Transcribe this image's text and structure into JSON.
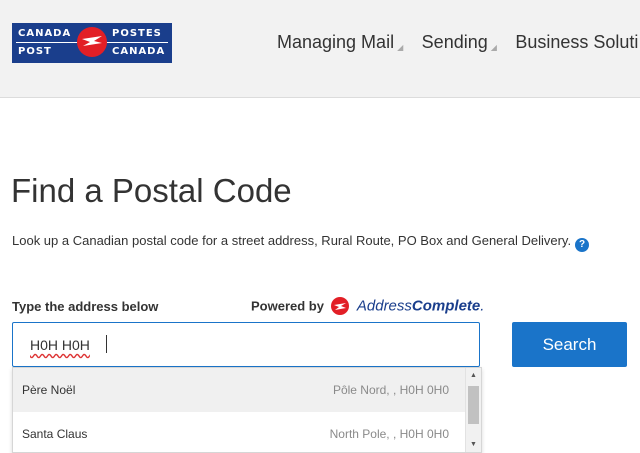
{
  "header": {
    "logo": {
      "line1_left": "CANADA",
      "line1_right": "POSTES",
      "line2_left": "POST",
      "line2_right": "CANADA"
    },
    "nav": [
      {
        "label": "Managing Mail"
      },
      {
        "label": "Sending"
      },
      {
        "label": "Business Soluti"
      }
    ]
  },
  "main": {
    "title": "Find a Postal Code",
    "description": "Look up a Canadian postal code for a street address, Rural Route, PO Box and General Delivery.",
    "help_icon": "?",
    "address_label": "Type the address below",
    "powered_by": "Powered by",
    "provider_name_part1": "Address",
    "provider_name_part2": "Complete",
    "provider_suffix": ".",
    "input_value": "H0H H0H",
    "search_label": "Search",
    "suggestions": [
      {
        "name": "Père Noël",
        "address": "Pôle Nord, , H0H 0H0"
      },
      {
        "name": "Santa Claus",
        "address": "North Pole, , H0H 0H0"
      }
    ]
  },
  "icons": {
    "scroll_up": "scroll-up-arrow-icon",
    "scroll_down": "scroll-down-arrow-icon",
    "nav_indicator": "nav-corner-triangle-icon"
  },
  "colors": {
    "brand_blue": "#1a3e8c",
    "brand_red": "#e21f26",
    "accent_blue": "#1a74c9",
    "header_bg": "#f2f2f2"
  }
}
